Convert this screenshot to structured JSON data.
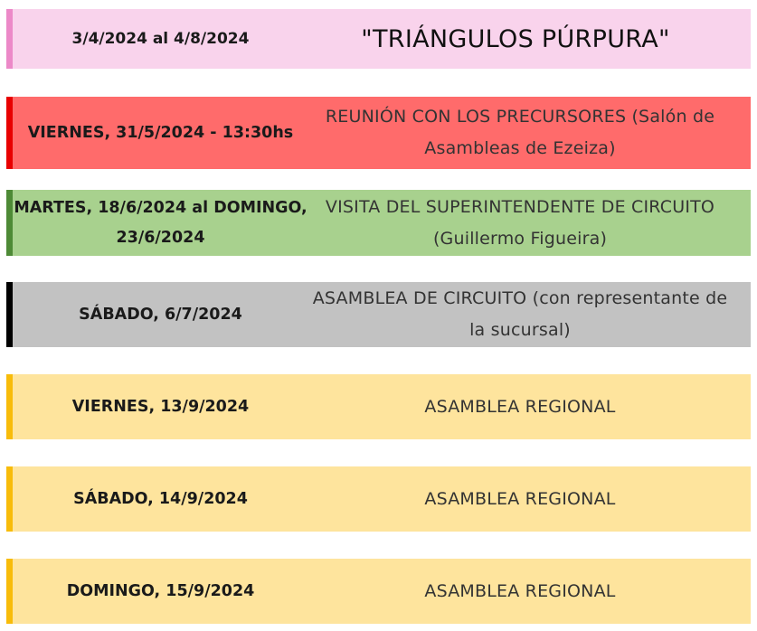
{
  "schedule": {
    "header": {
      "date": "3/4/2024 al 4/8/2024",
      "event": "\"TRIÁNGULOS PÚRPURA\"",
      "bg_color": "#f9d3ec",
      "accent_color": "#ec89c8"
    },
    "rows": [
      {
        "date": "VIERNES, 31/5/2024 - 13:30hs",
        "event": "REUNIÓN CON LOS PRECURSORES (Salón de Asambleas de Ezeiza)",
        "bg_color": "#ff6b6b",
        "accent_color": "#e80000"
      },
      {
        "date": "MARTES, 18/6/2024 al DOMINGO, 23/6/2024",
        "event": "VISITA DEL SUPERINTENDENTE DE CIRCUITO (Guillermo Figueira)",
        "bg_color": "#a8d18e",
        "accent_color": "#4e8a36"
      },
      {
        "date": "SÁBADO, 6/7/2024",
        "event": "ASAMBLEA DE CIRCUITO (con representante de la sucursal)",
        "bg_color": "#c2c2c2",
        "accent_color": "#000000"
      },
      {
        "date": "VIERNES, 13/9/2024",
        "event": "ASAMBLEA REGIONAL",
        "bg_color": "#fee49d",
        "accent_color": "#f8bc0a"
      },
      {
        "date": "SÁBADO, 14/9/2024",
        "event": "ASAMBLEA REGIONAL",
        "bg_color": "#fee49d",
        "accent_color": "#f8bc0a"
      },
      {
        "date": "DOMINGO, 15/9/2024",
        "event": "ASAMBLEA REGIONAL",
        "bg_color": "#fee49d",
        "accent_color": "#f8bc0a"
      }
    ]
  }
}
